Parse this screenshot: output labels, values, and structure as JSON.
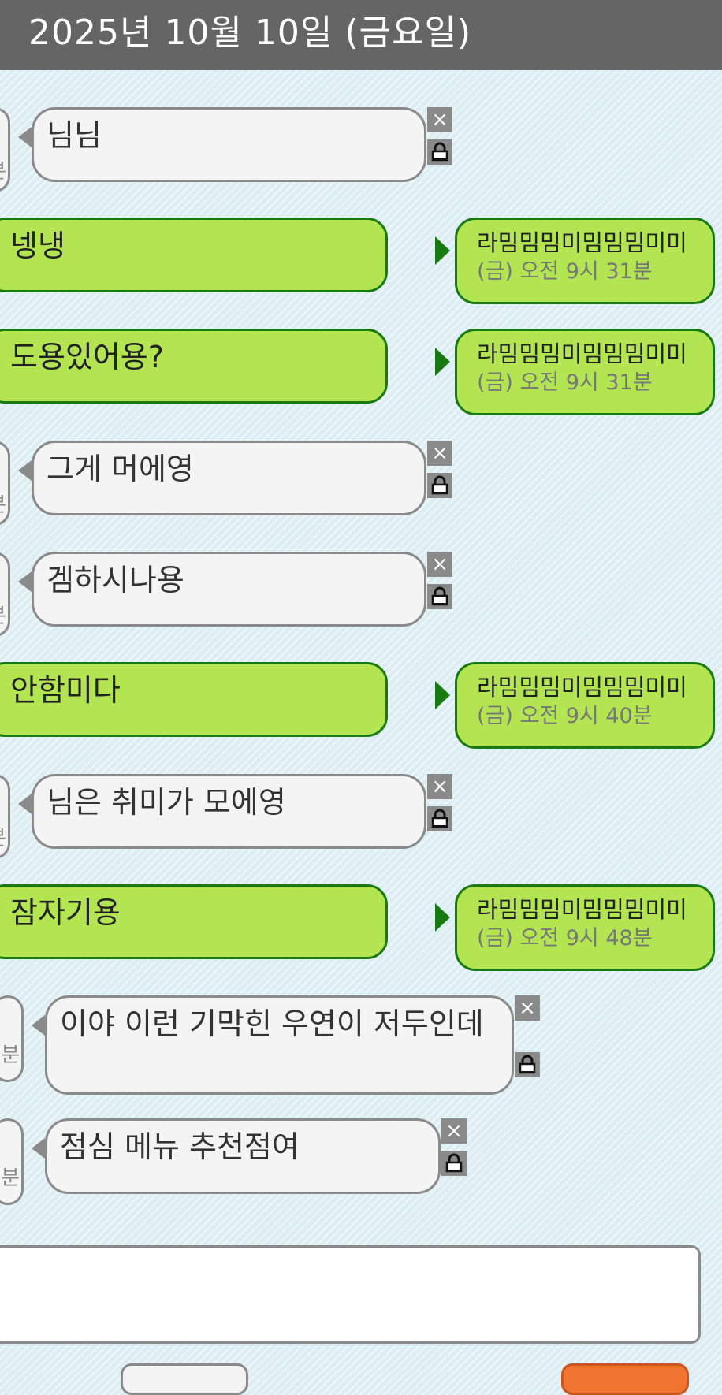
{
  "header": {
    "date": "2025년 10월 10일 (금요일)"
  },
  "messages": [
    {
      "kind": "in",
      "text": "님님",
      "stub": "분",
      "delete_icon": "×"
    },
    {
      "kind": "out",
      "text": "넹냉",
      "sender": "라밈밈밈미밈밈밈미미",
      "time": "(금) 오전 9시 31분"
    },
    {
      "kind": "out",
      "text": "도용있어용?",
      "sender": "라밈밈밈미밈밈밈미미",
      "time": "(금) 오전 9시 31분"
    },
    {
      "kind": "in",
      "text": "그게 머에영",
      "stub": "분",
      "delete_icon": "×"
    },
    {
      "kind": "in",
      "text": "겜하시나용",
      "stub": "분",
      "delete_icon": "×"
    },
    {
      "kind": "out",
      "text": "안함미다",
      "sender": "라밈밈밈미밈밈밈미미",
      "time": "(금) 오전 9시 40분"
    },
    {
      "kind": "in",
      "text": "님은 취미가 모에영",
      "stub": "분",
      "delete_icon": "×"
    },
    {
      "kind": "out",
      "text": "잠자기용",
      "sender": "라밈밈밈미밈밈밈미미",
      "time": "(금) 오전 9시 48분"
    },
    {
      "kind": "in",
      "text": "이야 이런 기막힌 우연이 저두인데",
      "stub": "분",
      "delete_icon": "×"
    },
    {
      "kind": "in",
      "text": "점심 메뉴 추천점여",
      "stub": "분",
      "delete_icon": "×"
    }
  ],
  "colors": {
    "header_bg": "#656565",
    "out_bubble": "#b2e551",
    "out_border": "#1a7a12",
    "in_bubble": "#f4f4f4",
    "send_button": "#f07530"
  },
  "icons": {
    "delete": "close-icon",
    "lock": "lock-icon"
  }
}
